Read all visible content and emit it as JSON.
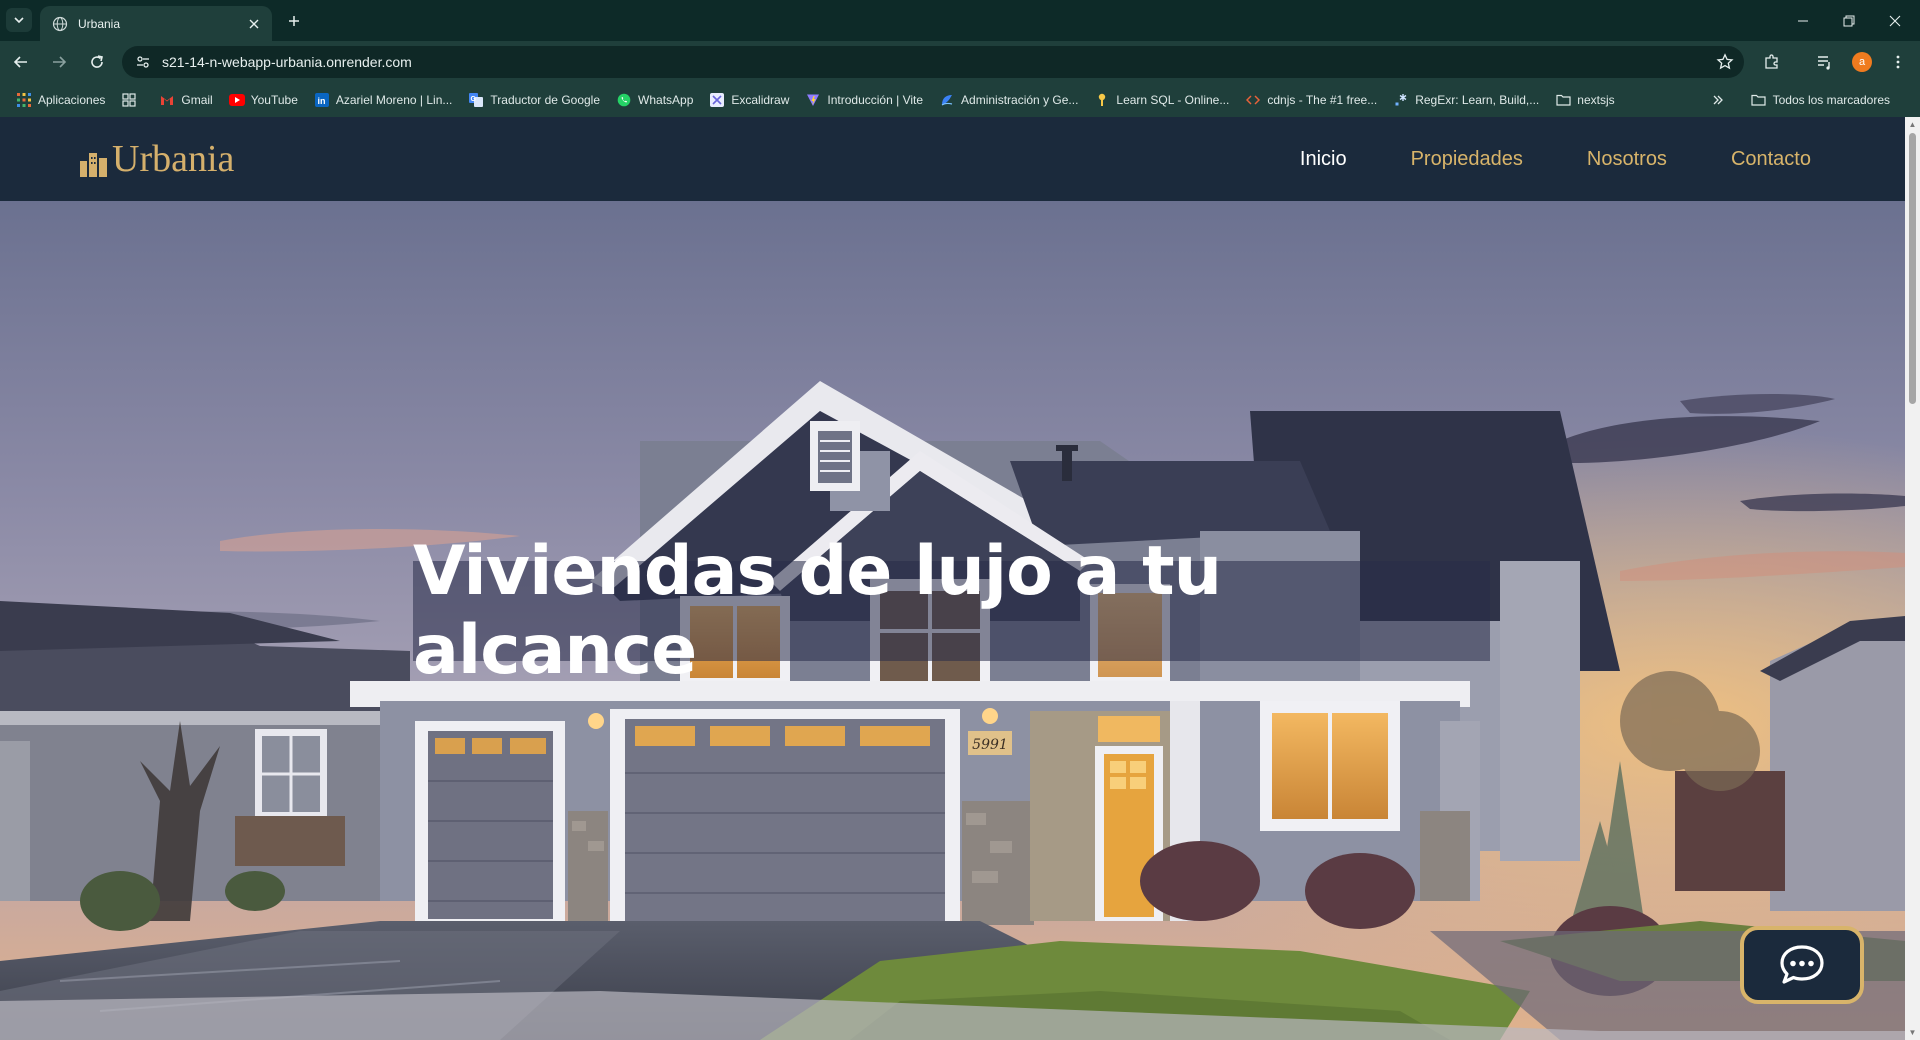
{
  "browser": {
    "tab": {
      "title": "Urbania",
      "favicon": "globe-icon"
    },
    "url": "s21-14-n-webapp-urbania.onrender.com",
    "profile_initial": "a",
    "bookmarks": [
      {
        "label": "Aplicaciones",
        "icon": "apps-grid-icon"
      },
      {
        "label": "",
        "icon": "grid-icon"
      },
      {
        "label": "Gmail",
        "icon": "gmail-icon"
      },
      {
        "label": "YouTube",
        "icon": "youtube-icon"
      },
      {
        "label": "Azariel Moreno | Lin...",
        "icon": "linkedin-icon"
      },
      {
        "label": "Traductor de Google",
        "icon": "translate-icon"
      },
      {
        "label": "WhatsApp",
        "icon": "whatsapp-icon"
      },
      {
        "label": "Excalidraw",
        "icon": "excalidraw-icon"
      },
      {
        "label": "Introducción | Vite",
        "icon": "vite-icon"
      },
      {
        "label": "Administración y Ge...",
        "icon": "admin-icon"
      },
      {
        "label": "Learn SQL - Online...",
        "icon": "sql-icon"
      },
      {
        "label": "cdnjs - The #1 free...",
        "icon": "code-icon"
      },
      {
        "label": "RegExr: Learn, Build,...",
        "icon": "regexr-icon"
      },
      {
        "label": "nextsjs",
        "icon": "folder-icon"
      }
    ],
    "all_bookmarks": "Todos los marcadores"
  },
  "site": {
    "logo_text": "Urbania",
    "nav": [
      {
        "label": "Inicio",
        "active": true
      },
      {
        "label": "Propiedades",
        "active": false
      },
      {
        "label": "Nosotros",
        "active": false
      },
      {
        "label": "Contacto",
        "active": false
      }
    ],
    "hero_title": "Viviendas de lujo a tu alcance",
    "house_number": "5991",
    "colors": {
      "header_bg": "#1b2a3c",
      "accent_gold": "#d8b46a"
    }
  }
}
